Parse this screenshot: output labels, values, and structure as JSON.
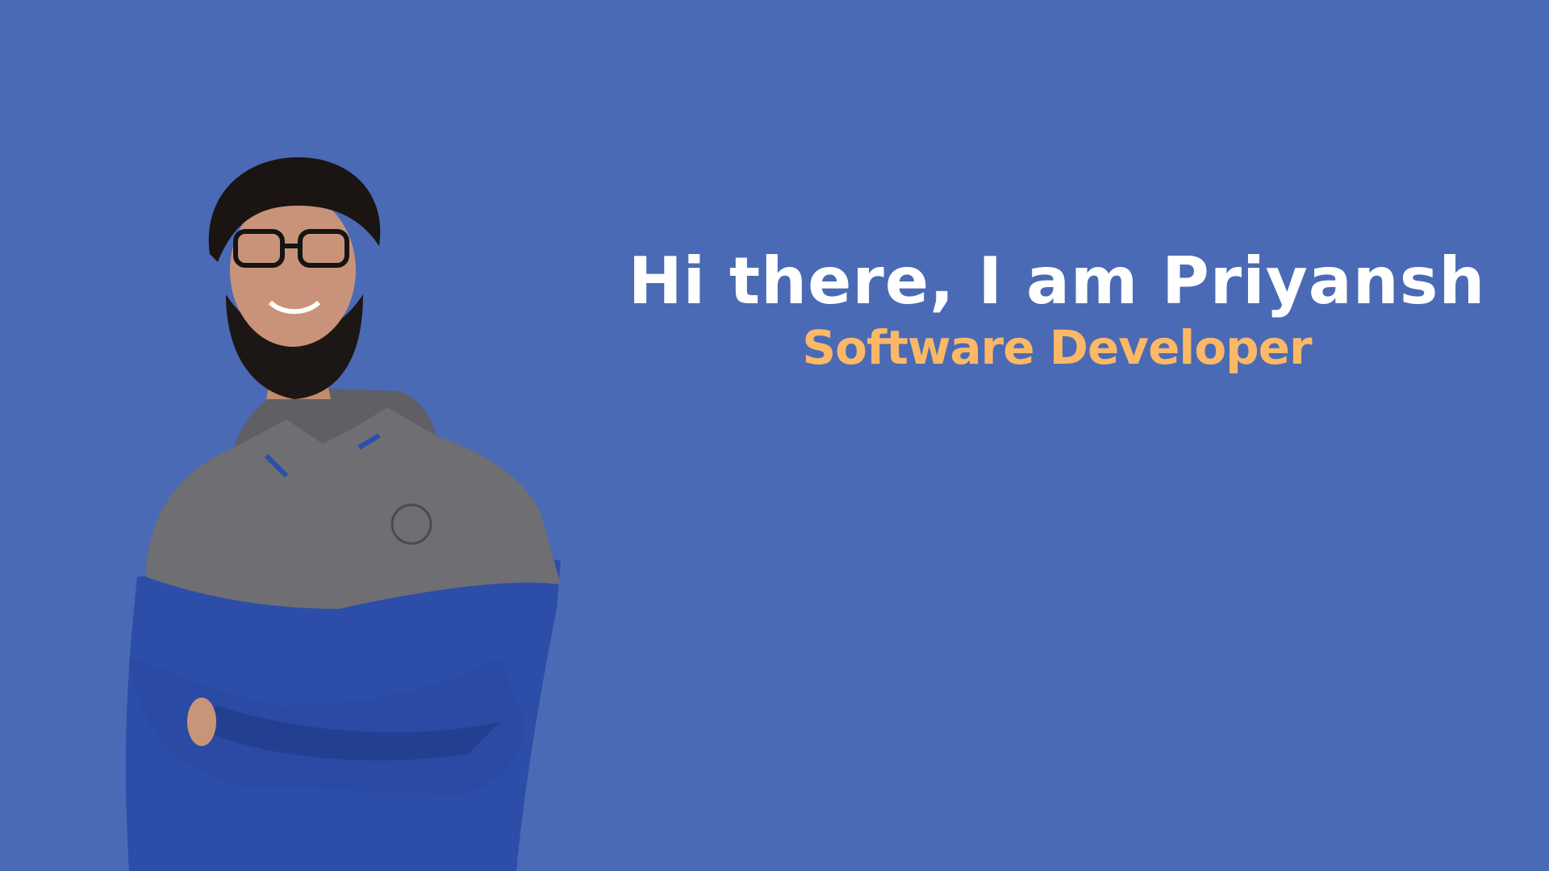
{
  "hero": {
    "greeting": "Hi there, I am Priyansh",
    "role": "Software Developer"
  },
  "portrait": {
    "icon": "person-portrait-photo"
  },
  "colors": {
    "background": "#4a6ab5",
    "greeting_text": "#ffffff",
    "role_text": "#fbb867",
    "hoodie_gray": "#6b6b70",
    "hoodie_blue": "#2c4ea8"
  }
}
